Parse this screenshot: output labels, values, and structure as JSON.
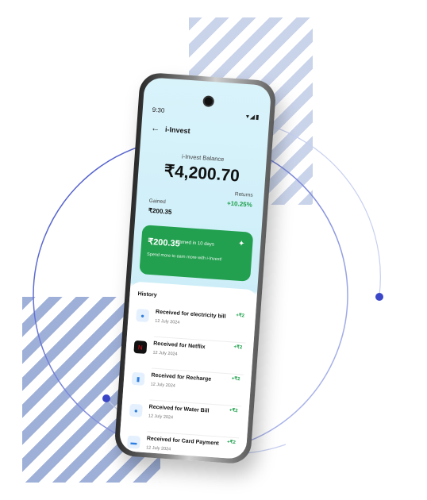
{
  "status": {
    "time": "9:30",
    "icons": "▾◢▮"
  },
  "header": {
    "title": "i-Invest"
  },
  "balance": {
    "label": "i-Invest Balance",
    "value": "₹4,200.70"
  },
  "stats": {
    "gained_label": "Gained",
    "gained_value": "₹200.35",
    "returns_label": "Returns",
    "returns_value": "+10.25%"
  },
  "gain_card": {
    "amount": "₹200.35",
    "days": "earned in 10 days",
    "subtitle": "Spend more to earn more with i-Invest!"
  },
  "history": {
    "title": "History",
    "items": [
      {
        "name": "Received for electricity bill",
        "date": "12 July 2024",
        "amount": "+₹2",
        "icon": "location-icon",
        "glyph": "●",
        "color": "#2f7fe0",
        "bg": "#e4f0fd"
      },
      {
        "name": "Received for Netflix",
        "date": "12 July 2024",
        "amount": "+₹2",
        "icon": "netflix-icon",
        "glyph": "N",
        "color": "#e50914",
        "bg": "#111111"
      },
      {
        "name": "Received for Recharge",
        "date": "12 July 2024",
        "amount": "+₹2",
        "icon": "phone-icon",
        "glyph": "▮",
        "color": "#2f7fe0",
        "bg": "#e4f0fd"
      },
      {
        "name": "Received for Water Bill",
        "date": "12 July 2024",
        "amount": "+₹2",
        "icon": "water-drop-icon",
        "glyph": "●",
        "color": "#2f7fe0",
        "bg": "#e4f0fd"
      },
      {
        "name": "Received for Card Payment",
        "date": "12 July 2024",
        "amount": "+₹2",
        "icon": "card-icon",
        "glyph": "▬",
        "color": "#2f7fe0",
        "bg": "#e4f0fd"
      }
    ]
  }
}
